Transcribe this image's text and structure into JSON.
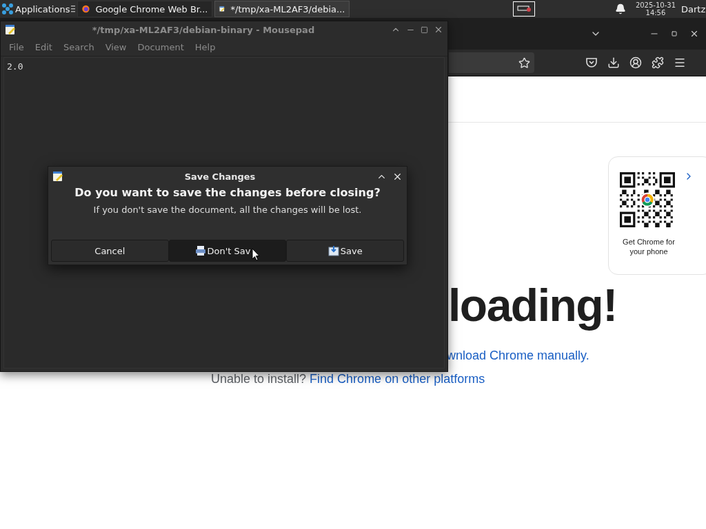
{
  "taskbar": {
    "apps_menu": "Applications",
    "tasks": [
      {
        "label": "Google Chrome Web Br...",
        "kind": "browser",
        "selected": false
      },
      {
        "label": "*/tmp/xa-ML2AF3/debia...",
        "kind": "editor",
        "selected": true
      }
    ],
    "date": "2025-10-31",
    "time": "14:56",
    "user": "Dartz"
  },
  "browser": {
    "heading": "loading!",
    "download_link": "wnload Chrome manually.",
    "install_prompt": "Unable to install?",
    "platforms_link": "Find Chrome on other platforms",
    "qr_card": {
      "caption": "Get Chrome for your phone"
    }
  },
  "editor": {
    "title": "*/tmp/xa-ML2AF3/debian-binary - Mousepad",
    "menu": [
      "File",
      "Edit",
      "Search",
      "View",
      "Document",
      "Help"
    ],
    "content": "2.0"
  },
  "dialog": {
    "title": "Save Changes",
    "heading": "Do you want to save the changes before closing?",
    "message": "If you don't save the document, all the changes will be lost.",
    "buttons": [
      {
        "label": "Cancel",
        "kind": "cancel",
        "selected": false
      },
      {
        "label": "Don't Sav",
        "kind": "discard",
        "selected": true
      },
      {
        "label": "Save",
        "kind": "save",
        "selected": false
      }
    ]
  }
}
